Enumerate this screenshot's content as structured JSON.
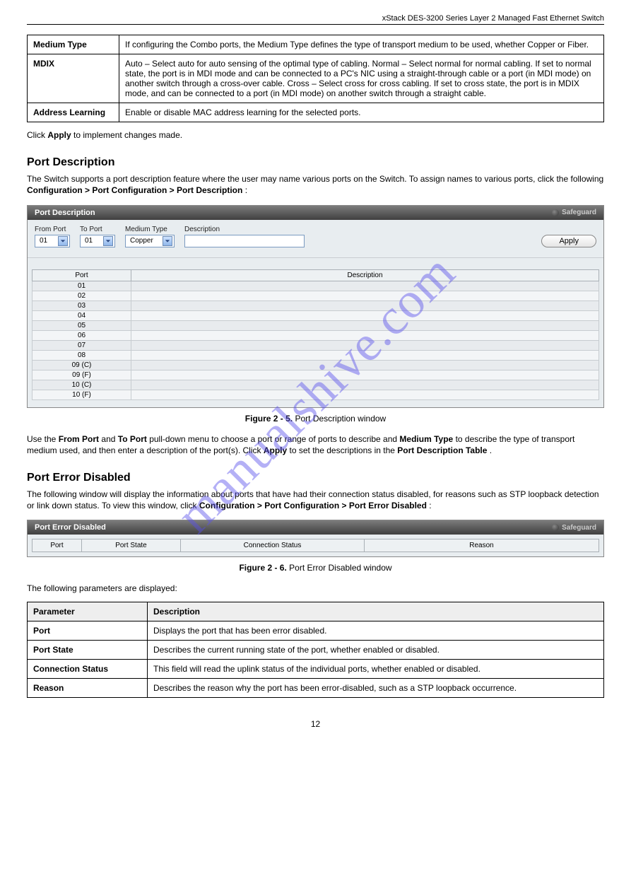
{
  "header": {
    "text": "xStack DES-3200 Series Layer 2 Managed Fast Ethernet Switch"
  },
  "top_table": {
    "rows": [
      {
        "label": "Medium Type",
        "desc": "If configuring the Combo ports, the Medium Type defines the type of transport medium to be used, whether Copper or Fiber."
      },
      {
        "label": "MDIX",
        "desc": "Auto – Select auto for auto sensing of the optimal type of cabling. Normal – Select normal for normal cabling. If set to normal state, the port is in MDI mode and can be connected to a PC's NIC using a straight-through cable or a port (in MDI mode) on another switch through a cross-over cable. Cross – Select cross for cross cabling. If set to cross state, the port is in MDIX mode, and can be connected to a port (in MDI mode) on another switch through a straight cable."
      },
      {
        "label": "Address Learning",
        "desc": "Enable or disable MAC address learning for the selected ports."
      }
    ]
  },
  "apply_sentence": {
    "prefix": "Click ",
    "btn": "Apply",
    "suffix": " to implement changes made."
  },
  "section1": {
    "title": "Port Description",
    "intro": "The Switch supports a port description feature where the user may name various ports on the Switch. To assign names to various ports, click the following ",
    "nav": "Configuration > Port Configuration > Port Description",
    "outro": ":"
  },
  "panel1": {
    "title": "Port Description",
    "safeguard": "Safeguard",
    "labels": {
      "from": "From Port",
      "to": "To Port",
      "medium": "Medium Type",
      "desc": "Description"
    },
    "selects": {
      "from": "01",
      "to": "01",
      "medium": "Copper"
    },
    "apply": "Apply",
    "table": {
      "headers": {
        "port": "Port",
        "desc": "Description"
      },
      "ports": [
        "01",
        "02",
        "03",
        "04",
        "05",
        "06",
        "07",
        "08",
        "09 (C)",
        "09 (F)",
        "10 (C)",
        "10 (F)"
      ]
    }
  },
  "figure1": {
    "label": "Figure 2 - 5.",
    "text": " Port Description window"
  },
  "desc_para1": {
    "p1_a": "Use the ",
    "p1_b": "From Port",
    "p1_c": " and ",
    "p1_d": "To Port",
    "p1_e": " pull-down menu to choose a port or range of ports to describe and ",
    "p1_f": "Medium Type",
    "p1_g": " to describe the type of transport medium used, and then enter a description of the port(s). Click ",
    "p1_h": "Apply",
    "p1_i": " to set the descriptions in the ",
    "p1_j": "Port Description Table",
    "p1_k": "."
  },
  "section2": {
    "title": "Port Error Disabled",
    "intro": "The following window will display the information about ports that have had their connection status disabled, for reasons such as STP loopback detection or link down status. To view this window, click ",
    "nav": "Configuration > Port Configuration > Port Error Disabled",
    "outro": ":"
  },
  "panel2": {
    "title": "Port Error Disabled",
    "safeguard": "Safeguard",
    "headers": {
      "port": "Port",
      "state": "Port State",
      "conn": "Connection Status",
      "reason": "Reason"
    }
  },
  "figure2": {
    "label": "Figure 2 - 6.",
    "text": " Port Error Disabled window"
  },
  "fields_intro": "The following parameters are displayed:",
  "fields_table": {
    "header": {
      "param": "Parameter",
      "desc": "Description"
    },
    "rows": [
      {
        "param": "Port",
        "desc": "Displays the port that has been error disabled."
      },
      {
        "param": "Port State",
        "desc": "Describes the current running state of the port, whether enabled or disabled."
      },
      {
        "param": "Connection Status",
        "desc": "This field will read the uplink status of the individual ports, whether enabled or disabled."
      },
      {
        "param": "Reason",
        "desc": "Describes the reason why the port has been error-disabled, such as a STP loopback occurrence."
      }
    ]
  },
  "page_number": "12",
  "watermark": "manualshive.com"
}
